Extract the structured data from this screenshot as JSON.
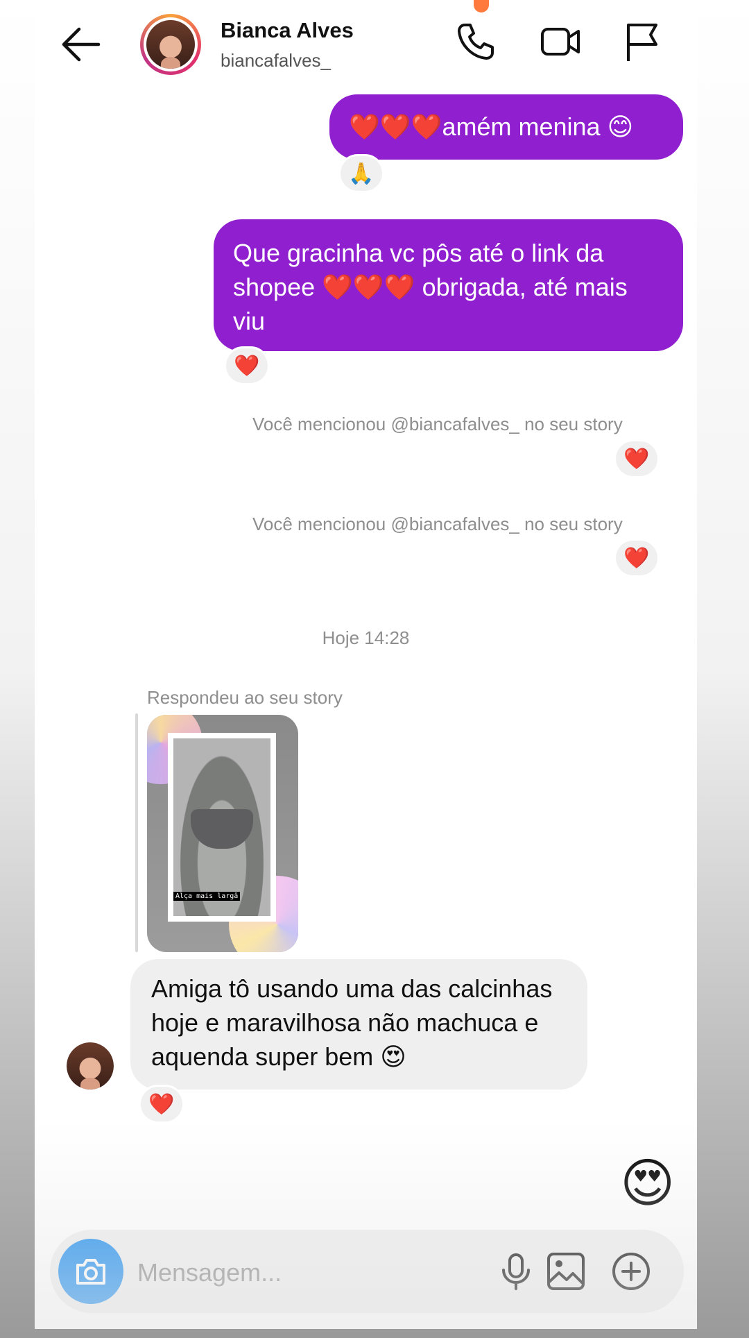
{
  "header": {
    "name": "Bianca Alves",
    "username": "biancafalves_",
    "icons": [
      "back-arrow-icon",
      "phone-icon",
      "video-icon",
      "flag-icon"
    ]
  },
  "messages": {
    "m1": {
      "text": "❤️❤️❤️amém menina 😊",
      "reaction": "🙏"
    },
    "m2": {
      "text": "Que gracinha vc pôs até o link da shopee ❤️❤️❤️ obrigada, até mais viu",
      "reaction": "❤️"
    },
    "mention1": {
      "text": "Você mencionou @biancafalves_ no seu story",
      "reaction": "❤️"
    },
    "mention2": {
      "text": "Você mencionou @biancafalves_ no seu story",
      "reaction": "❤️"
    },
    "timestamp": "Hoje 14:28",
    "story_reply": {
      "label": "Respondeu ao seu story",
      "caption": "Alça mais largâ"
    },
    "m3": {
      "text": "Amiga tô usando uma das calcinhas hoje e maravilhosa não machuca e aquenda super bem 😍",
      "reaction": "❤️"
    }
  },
  "quick_reaction": "😍",
  "composer": {
    "placeholder": "Mensagem...",
    "icons": [
      "camera-icon",
      "microphone-icon",
      "gallery-icon",
      "plus-circle-icon"
    ]
  },
  "colors": {
    "outgoing_bubble": "#8f1fcf",
    "incoming_bubble": "#efefef",
    "camera_button": "#1e8ff0"
  }
}
